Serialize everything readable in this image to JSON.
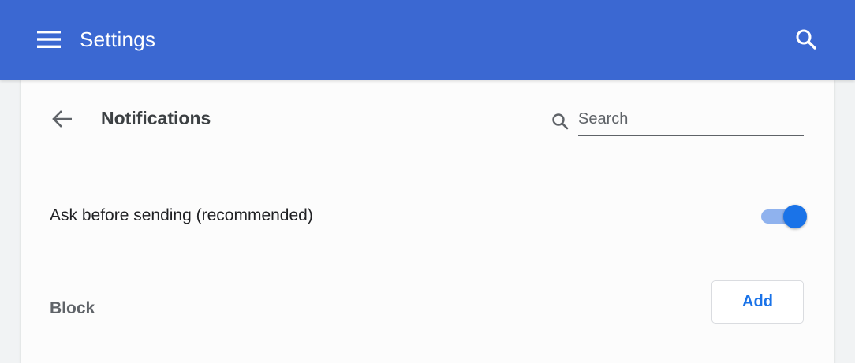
{
  "header": {
    "title": "Settings",
    "menu_icon": "hamburger-menu-icon",
    "search_icon": "search-icon",
    "background_color": "#3b68d2"
  },
  "subpage": {
    "title": "Notifications",
    "back_icon": "arrow-back-icon",
    "search": {
      "placeholder": "Search",
      "value": "",
      "icon": "search-icon"
    }
  },
  "settings": {
    "ask_before_sending": {
      "label": "Ask before sending (recommended)",
      "enabled": true,
      "accent_color": "#1a73e8"
    },
    "block": {
      "label": "Block",
      "add_button_label": "Add"
    }
  }
}
